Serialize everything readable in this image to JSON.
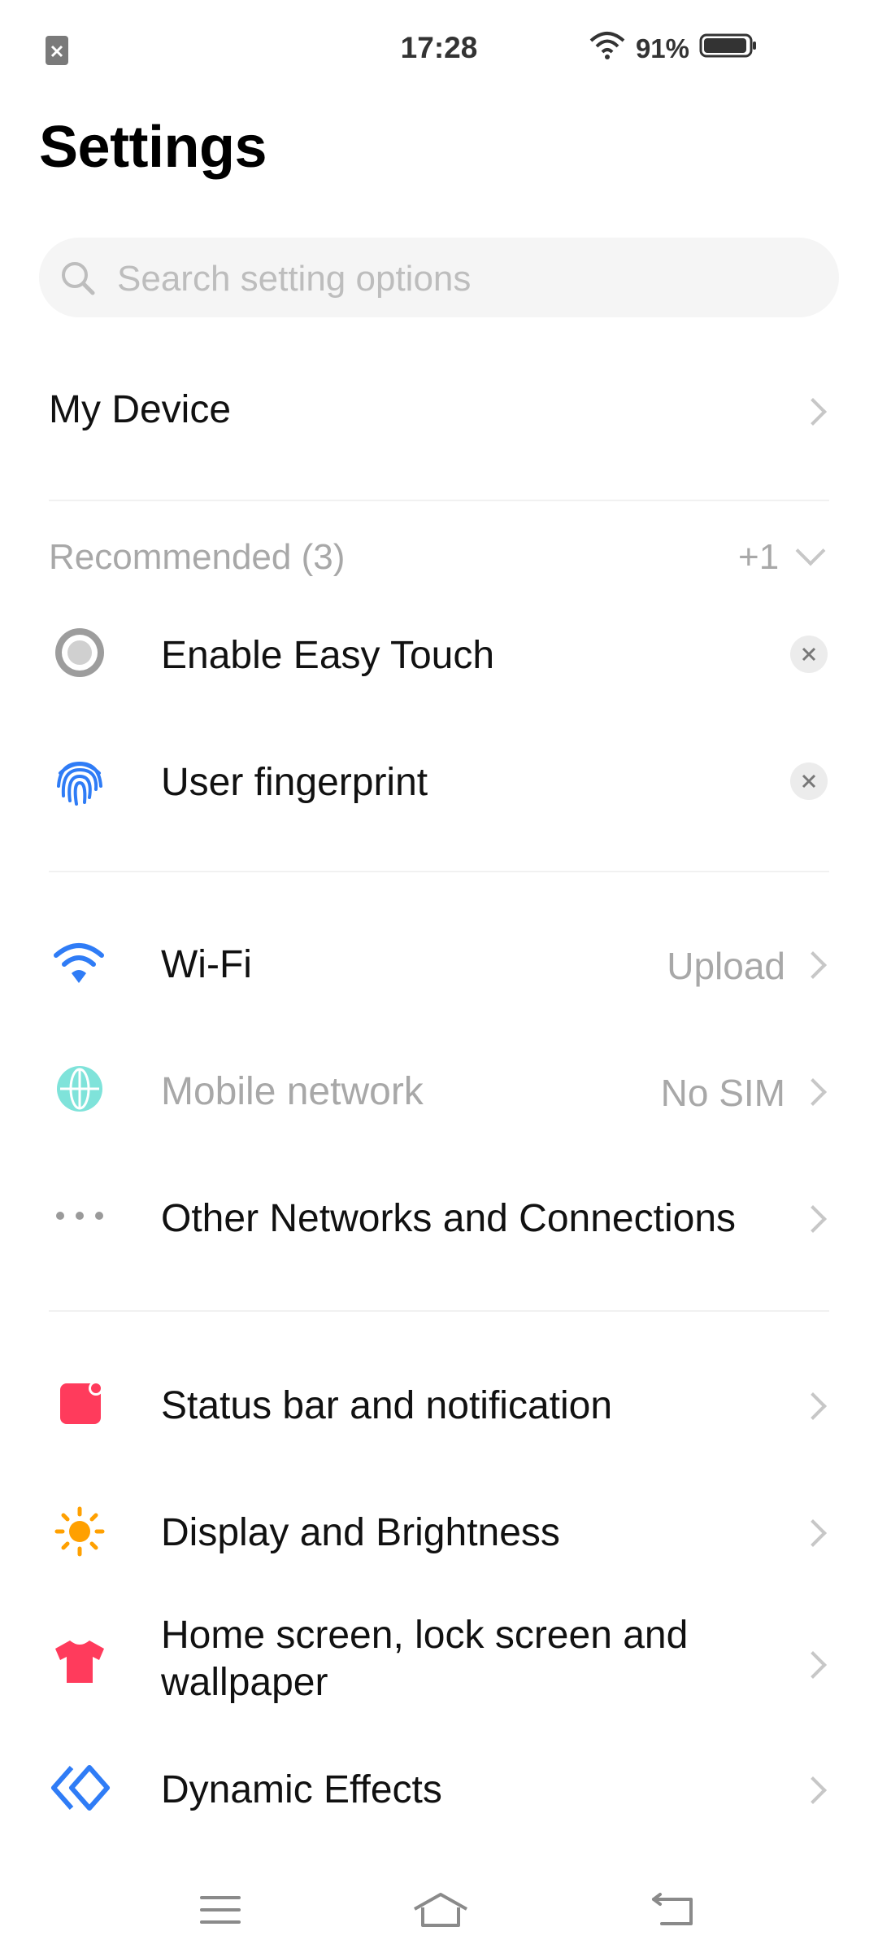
{
  "status_bar": {
    "time": "17:28",
    "battery_percent": "91%",
    "sim_status_icon": "no-sim-icon"
  },
  "header": {
    "title": "Settings"
  },
  "search": {
    "placeholder": "Search setting options"
  },
  "my_device": {
    "label": "My Device"
  },
  "recommended": {
    "header": "Recommended (3)",
    "more_count": "+1",
    "items": [
      {
        "label": "Enable Easy Touch",
        "icon": "easy-touch-icon"
      },
      {
        "label": "User fingerprint",
        "icon": "fingerprint-icon"
      }
    ]
  },
  "network_section": [
    {
      "label": "Wi-Fi",
      "value": "Upload",
      "icon": "wifi-icon",
      "color": "#2f7cf6"
    },
    {
      "label": "Mobile network",
      "value": "No SIM",
      "icon": "globe-icon",
      "color": "#7fe3da",
      "disabled": true
    },
    {
      "label": "Other Networks and Connections",
      "value": "",
      "icon": "more-dots-icon",
      "color": "#9a9a9a"
    }
  ],
  "display_section": [
    {
      "label": "Status bar and notification",
      "icon": "notification-icon",
      "color": "#ff3b5c"
    },
    {
      "label": "Display and Brightness",
      "icon": "sun-icon",
      "color": "#ffa000"
    },
    {
      "label_line1": "Home screen, lock screen and",
      "label_line2": "wallpaper",
      "icon": "tshirt-icon",
      "color": "#ff3b5c"
    },
    {
      "label": "Dynamic Effects",
      "icon": "dynamic-effects-icon",
      "color": "#2f7cf6"
    }
  ],
  "navbar": {
    "menu_icon": "menu-icon",
    "home_icon": "home-icon",
    "back_icon": "back-icon"
  }
}
